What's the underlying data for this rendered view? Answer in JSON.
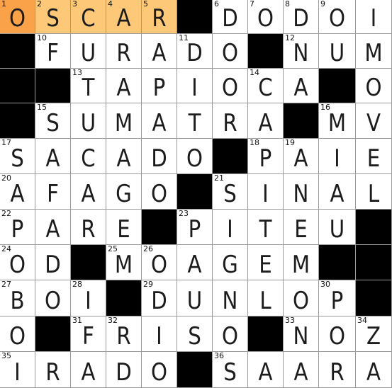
{
  "puzzle": {
    "rows": 11,
    "cols": 11,
    "selection": {
      "row": 0,
      "col": 0,
      "direction": "across"
    },
    "colors": {
      "selected_cell": "#f9a24a",
      "active_word": "#fdc878",
      "block": "#000000",
      "grid_line": "#9a9a9a"
    },
    "grid": [
      [
        "O",
        "S",
        "C",
        "A",
        "R",
        "#",
        "D",
        "O",
        "D",
        "O",
        "I"
      ],
      [
        "#",
        "F",
        "U",
        "R",
        "A",
        "D",
        "O",
        "#",
        "N",
        "U",
        "M"
      ],
      [
        "#",
        "#",
        "T",
        "A",
        "P",
        "I",
        "O",
        "C",
        "A",
        "#",
        "O"
      ],
      [
        "#",
        "S",
        "U",
        "M",
        "A",
        "T",
        "R",
        "A",
        "#",
        "M",
        "V"
      ],
      [
        "S",
        "A",
        "C",
        "A",
        "D",
        "O",
        "#",
        "P",
        "A",
        "I",
        "E"
      ],
      [
        "A",
        "F",
        "A",
        "G",
        "O",
        "#",
        "S",
        "I",
        "N",
        "A",
        "L"
      ],
      [
        "P",
        "A",
        "R",
        "E",
        "#",
        "P",
        "I",
        "T",
        "E",
        "U",
        "#"
      ],
      [
        "O",
        "D",
        "#",
        "M",
        "O",
        "A",
        "G",
        "E",
        "M",
        "#",
        "#"
      ],
      [
        "B",
        "O",
        "I",
        "#",
        "D",
        "U",
        "N",
        "L",
        "O",
        "P",
        "#"
      ],
      [
        "O",
        "#",
        "F",
        "R",
        "I",
        "S",
        "O",
        "#",
        "N",
        "O",
        "Z"
      ],
      [
        "I",
        "R",
        "A",
        "D",
        "O",
        "#",
        "S",
        "A",
        "A",
        "R",
        "A"
      ]
    ],
    "numbers": [
      [
        "1",
        "2",
        "3",
        "4",
        "5",
        "",
        "6",
        "7",
        "8",
        "9",
        ""
      ],
      [
        "",
        "10",
        "",
        "",
        "",
        "11",
        "",
        "",
        "12",
        "",
        ""
      ],
      [
        "",
        "",
        "13",
        "",
        "",
        "",
        "",
        "14",
        "",
        "",
        ""
      ],
      [
        "",
        "15",
        "",
        "",
        "",
        "",
        "",
        "",
        "",
        "16",
        ""
      ],
      [
        "17",
        "",
        "",
        "",
        "",
        "",
        "",
        "18",
        "19",
        "",
        ""
      ],
      [
        "20",
        "",
        "",
        "",
        "",
        "",
        "21",
        "",
        "",
        "",
        ""
      ],
      [
        "22",
        "",
        "",
        "",
        "",
        "23",
        "",
        "",
        "",
        "",
        ""
      ],
      [
        "24",
        "",
        "",
        "25",
        "26",
        "",
        "",
        "",
        "",
        "",
        ""
      ],
      [
        "27",
        "",
        "28",
        "",
        "29",
        "",
        "",
        "",
        "",
        "30",
        ""
      ],
      [
        "",
        "",
        "31",
        "32",
        "",
        "",
        "",
        "",
        "33",
        "",
        "34"
      ],
      [
        "35",
        "",
        "",
        "",
        "",
        "",
        "36",
        "",
        "",
        "",
        ""
      ]
    ]
  }
}
